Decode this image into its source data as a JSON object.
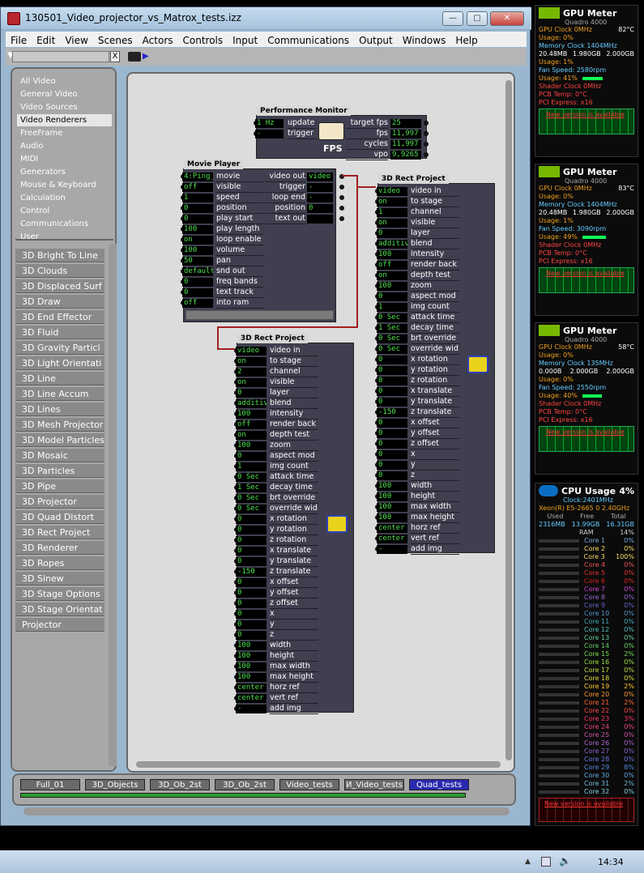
{
  "window": {
    "title": "130501_Video_projector_vs_Matrox_tests.izz",
    "minimize": "—",
    "maximize": "▢",
    "close": "✕"
  },
  "menus": [
    "File",
    "Edit",
    "View",
    "Scenes",
    "Actors",
    "Controls",
    "Input",
    "Communications",
    "Output",
    "Windows",
    "Help"
  ],
  "categories": [
    "All Video",
    "General Video",
    "Video Sources",
    "Video Renderers",
    "FreeFrame",
    "Audio",
    "MIDI",
    "Generators",
    "Mouse & Keyboard",
    "Calculation",
    "Control",
    "Communications",
    "User"
  ],
  "selected_category": "Video Renderers",
  "actors_list": [
    "3D Bright To Line",
    "3D Clouds",
    "3D Displaced Surf",
    "3D Draw",
    "3D End Effector",
    "3D Fluid",
    "3D Gravity Particl",
    "3D Light Orientati",
    "3D Line",
    "3D Line Accum",
    "3D Lines",
    "3D Mesh Projector",
    "3D Model Particles",
    "3D Mosaic",
    "3D Particles",
    "3D Pipe",
    "3D Projector",
    "3D Quad Distort",
    "3D Rect Project",
    "3D Renderer",
    "3D Ropes",
    "3D Sinew",
    "3D Stage Options",
    "3D Stage Orientat",
    "Projector"
  ],
  "perf": {
    "title": "Performance Monitor",
    "in": [
      [
        "1 Hz",
        "update"
      ],
      [
        "-",
        "trigger"
      ]
    ],
    "out": [
      [
        "target fps",
        "25"
      ],
      [
        "fps",
        "11,997"
      ],
      [
        "cycles",
        "11,997"
      ],
      [
        "vpo",
        "9,9265"
      ]
    ],
    "icon_label": "FPS"
  },
  "movie": {
    "title": "Movie Player",
    "in": [
      [
        "4:Ping_",
        "movie"
      ],
      [
        "off",
        "visible"
      ],
      [
        "1",
        "speed"
      ],
      [
        "0",
        "position"
      ],
      [
        "0",
        "play start"
      ],
      [
        "100",
        "play length"
      ],
      [
        "on",
        "loop enable"
      ],
      [
        "100",
        "volume"
      ],
      [
        "50",
        "pan"
      ],
      [
        "default",
        "snd out"
      ],
      [
        "0",
        "freq bands"
      ],
      [
        "0",
        "text track"
      ],
      [
        "off",
        "into ram"
      ]
    ],
    "out": [
      [
        "video out",
        "video"
      ],
      [
        "trigger",
        "-"
      ],
      [
        "loop end",
        "-"
      ],
      [
        "position",
        "0"
      ],
      [
        "text out",
        ""
      ]
    ]
  },
  "rect_params": [
    "video in",
    "to stage",
    "channel",
    "visible",
    "layer",
    "blend",
    "intensity",
    "render back",
    "depth test",
    "zoom",
    "aspect mod",
    "img count",
    "attack time",
    "decay time",
    "brt override",
    "override wid",
    "x rotation",
    "y rotation",
    "z rotation",
    "x translate",
    "y translate",
    "z translate",
    "x offset",
    "y offset",
    "z offset",
    "x",
    "y",
    "z",
    "width",
    "height",
    "max width",
    "max height",
    "horz ref",
    "vert ref",
    "add img"
  ],
  "rect1": {
    "title": "3D Rect Project",
    "values": [
      "video",
      "on",
      "1",
      "on",
      "0",
      "additive",
      "100",
      "off",
      "on",
      "100",
      "0",
      "1",
      "0 Sec",
      "1 Sec",
      "0 Sec",
      "0 Sec",
      "0",
      "0",
      "0",
      "0",
      "0",
      "-150",
      "0",
      "0",
      "0",
      "0",
      "0",
      "0",
      "100",
      "100",
      "100",
      "100",
      "center",
      "center",
      "-"
    ]
  },
  "rect2": {
    "title": "3D Rect Project",
    "values": [
      "video",
      "on",
      "2",
      "on",
      "0",
      "additive",
      "100",
      "off",
      "on",
      "100",
      "0",
      "1",
      "0 Sec",
      "1 Sec",
      "0 Sec",
      "0 Sec",
      "0",
      "0",
      "0",
      "0",
      "0",
      "-150",
      "0",
      "0",
      "0",
      "0",
      "0",
      "0",
      "100",
      "100",
      "100",
      "100",
      "center",
      "center",
      "-"
    ]
  },
  "scenes": [
    "Full_01",
    "3D_Objects",
    "3D_Ob_2st",
    "3D_Ob_2st",
    "Video_tests",
    "И_Video_tests",
    "Quad_tests"
  ],
  "active_scene": "Quad_tests",
  "gpus": [
    {
      "title": "GPU Meter",
      "model": "Quadro 4000",
      "clock": "GPU Clock 0MHz",
      "temp": "82°C",
      "usage": "Usage: 0%",
      "mem_clock": "Memory Clock 1404MHz",
      "used": "20.48MB",
      "free": "1.980GB",
      "total": "2.000GB",
      "mem_usage": "Usage: 1%",
      "fan": "Fan Speed: 2580rpm",
      "fan_usage": "Usage: 41%",
      "shader": "Shader Clock 0MHz",
      "pcb": "PCB Temp: 0°C",
      "pci": "PCI Express: x16",
      "notice": "New version is available",
      "fan_pct": 41
    },
    {
      "title": "GPU Meter",
      "model": "Quadro 4000",
      "clock": "GPU Clock 0MHz",
      "temp": "83°C",
      "usage": "Usage: 0%",
      "mem_clock": "Memory Clock 1404MHz",
      "used": "20.48MB",
      "free": "1.980GB",
      "total": "2.000GB",
      "mem_usage": "Usage: 1%",
      "fan": "Fan Speed: 3090rpm",
      "fan_usage": "Usage: 49%",
      "shader": "Shader Clock 0MHz",
      "pcb": "PCB Temp: 0°C",
      "pci": "PCI Express: x16",
      "notice": "New version is available",
      "fan_pct": 49
    },
    {
      "title": "GPU Meter",
      "model": "Quadro 4000",
      "clock": "GPU Clock 0MHz",
      "temp": "58°C",
      "usage": "Usage: 0%",
      "mem_clock": "Memory Clock 135MHz",
      "used": "0.000B",
      "free": "2.000GB",
      "total": "2.000GB",
      "mem_usage": "Usage: 0%",
      "fan": "Fan Speed: 2550rpm",
      "fan_usage": "Usage: 40%",
      "shader": "Shader Clock 0MHz",
      "pcb": "PCB Temp: 0°C",
      "pci": "PCI Express: x16",
      "notice": "New version is available",
      "fan_pct": 40
    }
  ],
  "cpu": {
    "title": "CPU Usage",
    "pct": "4%",
    "clock": "Clock:2401MHz",
    "model": "Xeon(R) E5-2665 0 2.40GHz",
    "used_label": "Used",
    "free_label": "Free",
    "total_label": "Total",
    "used": "2316MB",
    "free": "13.99GB",
    "total": "16.31GB",
    "ram": "RAM",
    "ram_pct": "14%",
    "cores": [
      [
        "Core 1",
        "0%"
      ],
      [
        "Core 2",
        "0%"
      ],
      [
        "Core 3",
        "100%"
      ],
      [
        "Core 4",
        "0%"
      ],
      [
        "Core 5",
        "0%"
      ],
      [
        "Core 6",
        "0%"
      ],
      [
        "Core 7",
        "0%"
      ],
      [
        "Core 8",
        "0%"
      ],
      [
        "Core 9",
        "0%"
      ],
      [
        "Core 10",
        "0%"
      ],
      [
        "Core 11",
        "0%"
      ],
      [
        "Core 12",
        "0%"
      ],
      [
        "Core 13",
        "0%"
      ],
      [
        "Core 14",
        "0%"
      ],
      [
        "Core 15",
        "2%"
      ],
      [
        "Core 16",
        "0%"
      ],
      [
        "Core 17",
        "0%"
      ],
      [
        "Core 18",
        "0%"
      ],
      [
        "Core 19",
        "2%"
      ],
      [
        "Core 20",
        "0%"
      ],
      [
        "Core 21",
        "2%"
      ],
      [
        "Core 22",
        "0%"
      ],
      [
        "Core 23",
        "3%"
      ],
      [
        "Core 24",
        "0%"
      ],
      [
        "Core 25",
        "0%"
      ],
      [
        "Core 26",
        "0%"
      ],
      [
        "Core 27",
        "0%"
      ],
      [
        "Core 28",
        "0%"
      ],
      [
        "Core 29",
        "8%"
      ],
      [
        "Core 30",
        "0%"
      ],
      [
        "Core 31",
        "2%"
      ],
      [
        "Core 32",
        "0%"
      ]
    ],
    "notice": "New version is available"
  },
  "clock": "14:34",
  "colors": {
    "green": "#4fe14f",
    "orange": "#f0a020",
    "accent": "#2a2ab0"
  }
}
